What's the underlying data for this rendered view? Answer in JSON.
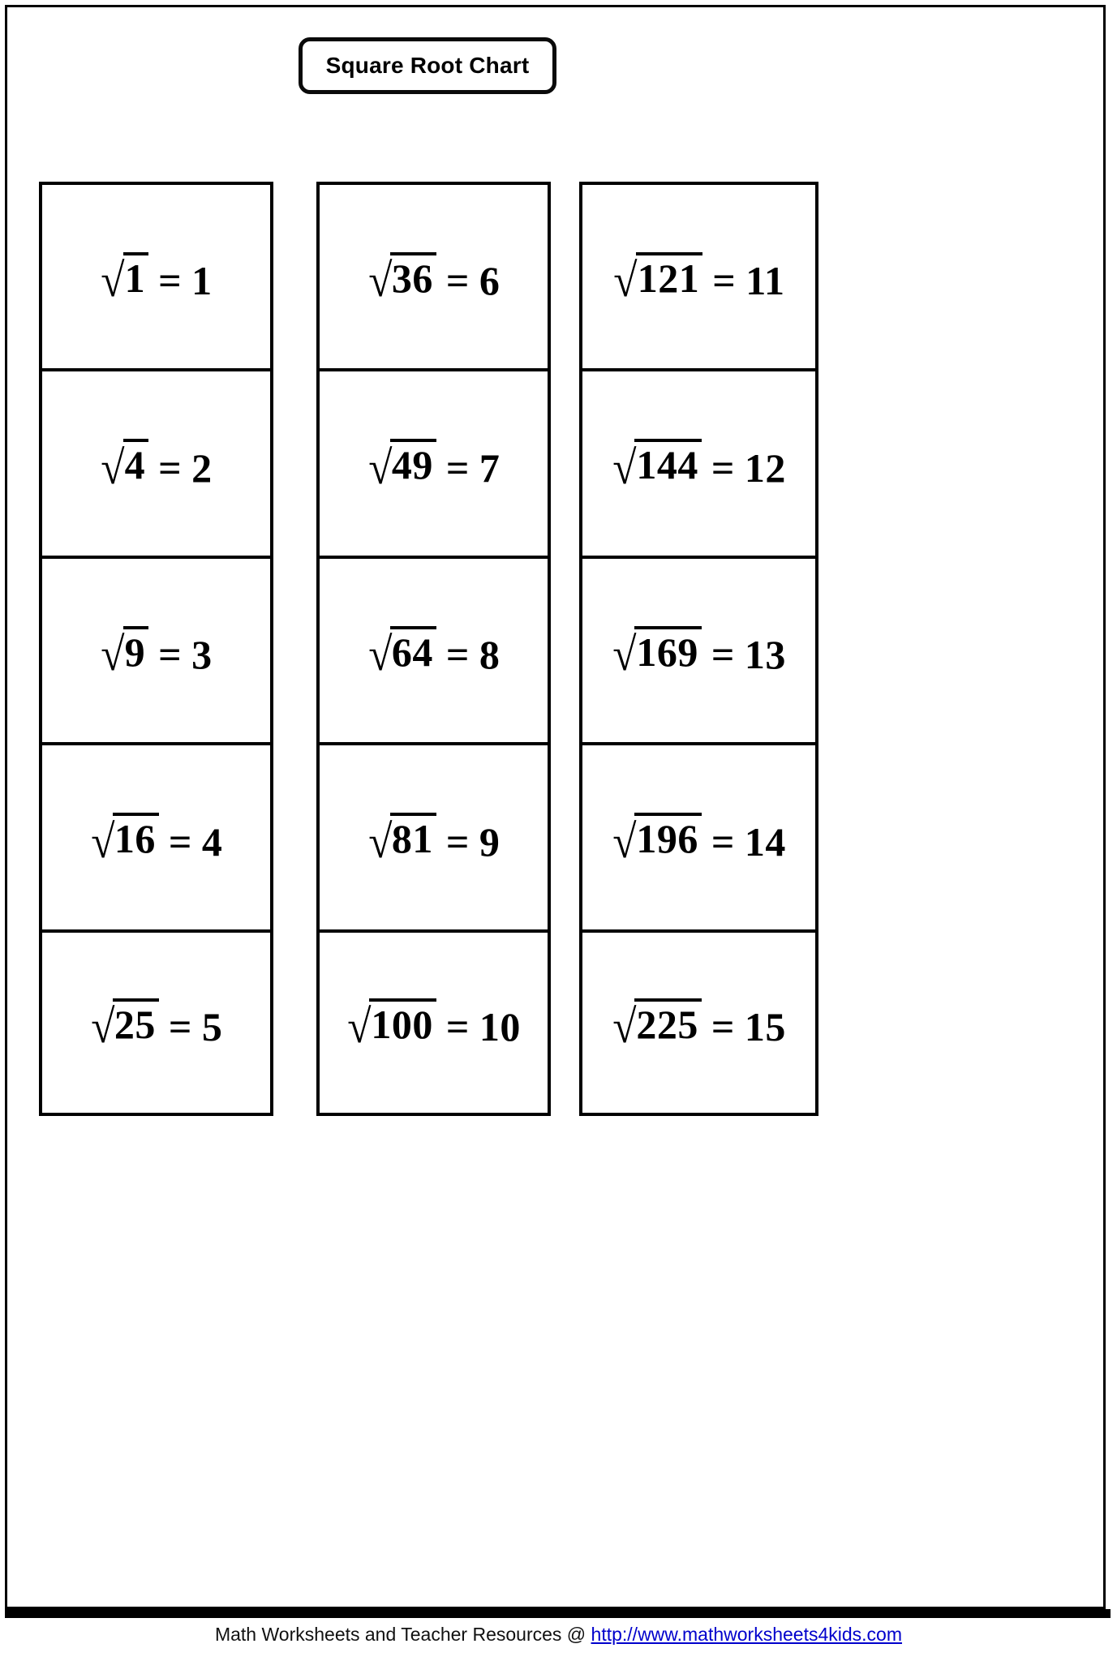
{
  "title": {
    "text": "Square Root Chart"
  },
  "chart_data": {
    "type": "table",
    "title": "Square Root Chart",
    "columns": 3,
    "rows": 5,
    "cells": [
      {
        "radicand": "1",
        "result": "1",
        "operator": "=",
        "radical": "√"
      },
      {
        "radicand": "4",
        "result": "2",
        "operator": "=",
        "radical": "√"
      },
      {
        "radicand": "9",
        "result": "3",
        "operator": "=",
        "radical": "√"
      },
      {
        "radicand": "16",
        "result": "4",
        "operator": "=",
        "radical": "√"
      },
      {
        "radicand": "25",
        "result": "5",
        "operator": "=",
        "radical": "√"
      },
      {
        "radicand": "36",
        "result": "6",
        "operator": "=",
        "radical": "√"
      },
      {
        "radicand": "49",
        "result": "7",
        "operator": "=",
        "radical": "√"
      },
      {
        "radicand": "64",
        "result": "8",
        "operator": "=",
        "radical": "√"
      },
      {
        "radicand": "81",
        "result": "9",
        "operator": "=",
        "radical": "√"
      },
      {
        "radicand": "100",
        "result": "10",
        "operator": "=",
        "radical": "√"
      },
      {
        "radicand": "121",
        "result": "11",
        "operator": "=",
        "radical": "√"
      },
      {
        "radicand": "144",
        "result": "12",
        "operator": "=",
        "radical": "√"
      },
      {
        "radicand": "169",
        "result": "13",
        "operator": "=",
        "radical": "√"
      },
      {
        "radicand": "196",
        "result": "14",
        "operator": "=",
        "radical": "√"
      },
      {
        "radicand": "225",
        "result": "15",
        "operator": "=",
        "radical": "√"
      }
    ]
  },
  "columns": [
    {
      "cells": [
        {
          "radical": "√",
          "radicand": "1",
          "operator": "=",
          "result": "1"
        },
        {
          "radical": "√",
          "radicand": "4",
          "operator": "=",
          "result": "2"
        },
        {
          "radical": "√",
          "radicand": "9",
          "operator": "=",
          "result": "3"
        },
        {
          "radical": "√",
          "radicand": "16",
          "operator": "=",
          "result": "4"
        },
        {
          "radical": "√",
          "radicand": "25",
          "operator": "=",
          "result": "5"
        }
      ]
    },
    {
      "cells": [
        {
          "radical": "√",
          "radicand": "36",
          "operator": "=",
          "result": "6"
        },
        {
          "radical": "√",
          "radicand": "49",
          "operator": "=",
          "result": "7"
        },
        {
          "radical": "√",
          "radicand": "64",
          "operator": "=",
          "result": "8"
        },
        {
          "radical": "√",
          "radicand": "81",
          "operator": "=",
          "result": "9"
        },
        {
          "radical": "√",
          "radicand": "100",
          "operator": "=",
          "result": "10"
        }
      ]
    },
    {
      "cells": [
        {
          "radical": "√",
          "radicand": "121",
          "operator": "=",
          "result": "11"
        },
        {
          "radical": "√",
          "radicand": "144",
          "operator": "=",
          "result": "12"
        },
        {
          "radical": "√",
          "radicand": "169",
          "operator": "=",
          "result": "13"
        },
        {
          "radical": "√",
          "radicand": "196",
          "operator": "=",
          "result": "14"
        },
        {
          "radical": "√",
          "radicand": "225",
          "operator": "=",
          "result": "15"
        }
      ]
    }
  ],
  "footer": {
    "text": "Math Worksheets and Teacher Resources @ ",
    "link": "http://www.mathworksheets4kids.com",
    "link_color": "#0000cc"
  }
}
